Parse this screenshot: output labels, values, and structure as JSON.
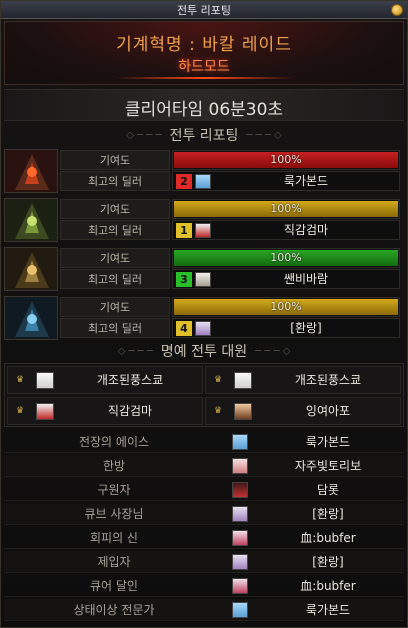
{
  "window": {
    "title": "전투 리포팅"
  },
  "raid": {
    "name": "기계혁명 : 바칼 레이드",
    "mode": "하드모드"
  },
  "clear": {
    "label": "클리어타임  06분30초"
  },
  "sections": {
    "battle_report": "전투 리포팅",
    "honor": "명예 전투 대원"
  },
  "labels": {
    "contribution": "기여도",
    "top_dealer": "최고의 딜러"
  },
  "colors": {
    "bar_red": "#b01010",
    "bar_gold": "#b8900e",
    "bar_green": "#1e8a1a"
  },
  "bosses": [
    {
      "boss_icon": "red-dragon-portrait-icon",
      "contribution": "100%",
      "contribution_value": 100,
      "bar_color": "#b01010",
      "rank": "2",
      "rank_color": "#e02a2a",
      "dealer": "룩가본드"
    },
    {
      "boss_icon": "green-dragon-portrait-icon",
      "contribution": "100%",
      "contribution_value": 100,
      "bar_color": "#b8900e",
      "rank": "1",
      "rank_color": "#e0c02a",
      "dealer": "직감검마"
    },
    {
      "boss_icon": "gold-dragon-portrait-icon",
      "contribution": "100%",
      "contribution_value": 100,
      "bar_color": "#1e8a1a",
      "rank": "3",
      "rank_color": "#2ac02a",
      "dealer": "쌘비바람"
    },
    {
      "boss_icon": "blue-dragon-portrait-icon",
      "contribution": "100%",
      "contribution_value": 100,
      "bar_color": "#b8900e",
      "rank": "4",
      "rank_color": "#e0c02a",
      "dealer": "[환랑]"
    }
  ],
  "honor": [
    "개조된풍스쿄",
    "개조된풍스쿄",
    "직감검마",
    "잉여아포"
  ],
  "awards": [
    {
      "title": "전장의 에이스",
      "name": "룩가본드"
    },
    {
      "title": "한방",
      "name": "자주빛토리보"
    },
    {
      "title": "구원자",
      "name": "담롯"
    },
    {
      "title": "큐브 사장님",
      "name": "[환랑]"
    },
    {
      "title": "회피의 신",
      "name": "血:bubfer"
    },
    {
      "title": "제입자",
      "name": "[환랑]"
    },
    {
      "title": "큐어 달인",
      "name": "血:bubfer"
    },
    {
      "title": "상태이상 전문가",
      "name": "룩가본드"
    }
  ]
}
